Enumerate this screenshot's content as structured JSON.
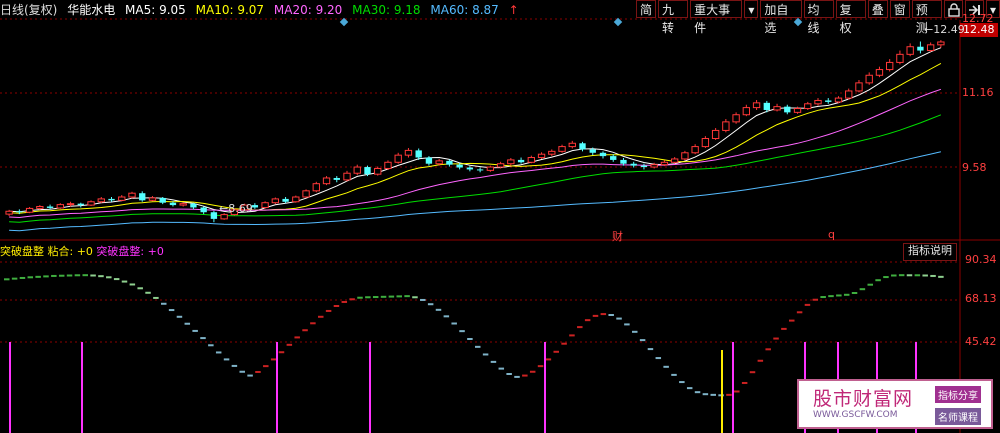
{
  "header": {
    "period": "日线(复权)",
    "stock_name": "华能水电",
    "ma5": "MA5: 9.05",
    "ma10": "MA10: 9.07",
    "ma20": "MA20: 9.20",
    "ma30": "MA30: 9.18",
    "ma60": "MA60: 8.87",
    "arrow": "↑"
  },
  "toolbar": {
    "simple": "简",
    "nine_turn": "九转",
    "major_events": "重大事件",
    "dropdown_arrow": "▾",
    "add_watch": "加自选",
    "ma_line": "均线",
    "adjust": "复权",
    "overlay": "叠",
    "window": "窗",
    "forecast": "预测",
    "lock_icon": "lock-icon",
    "pin_icon": "pin-icon"
  },
  "price_axis": {
    "labels": [
      "12.72",
      "11.16",
      "9.58"
    ],
    "current_price": "12.48"
  },
  "annotations": {
    "high": "12.49",
    "low": "8.69",
    "marker_cai": "财",
    "marker_q": "q"
  },
  "indicator": {
    "name": "突破盘整",
    "stick": "粘合: +0",
    "breakout": "突破盘整: +0",
    "button": "指标说明",
    "axis_labels": [
      "90.34",
      "68.13",
      "45.42"
    ]
  },
  "watermark": {
    "main": "股市财富网",
    "url": "WWW.GSCFW.COM",
    "tag1": "指标分享",
    "tag2": "名师课程"
  },
  "colors": {
    "up": "#ff3838",
    "down": "#55ffff",
    "ma5": "#ffffff",
    "ma10": "#ffff00",
    "ma20": "#ff66ff",
    "ma30": "#00dd00",
    "ma60": "#55bbff",
    "grid": "#8b0000",
    "signal": "#ff33ff",
    "accent_yellow": "#ffee00"
  },
  "chart_data": {
    "type": "candlestick",
    "ylim": [
      8.4,
      12.9
    ],
    "candles": [
      [
        8.86,
        8.92,
        8.82,
        8.95
      ],
      [
        8.92,
        8.9,
        8.86,
        8.96
      ],
      [
        8.9,
        8.98,
        8.88,
        9.01
      ],
      [
        8.98,
        9.02,
        8.95,
        9.05
      ],
      [
        9.02,
        8.99,
        8.96,
        9.06
      ],
      [
        8.99,
        9.06,
        8.97,
        9.09
      ],
      [
        9.06,
        9.08,
        9.02,
        9.12
      ],
      [
        9.08,
        9.05,
        9.0,
        9.1
      ],
      [
        9.05,
        9.12,
        9.03,
        9.15
      ],
      [
        9.12,
        9.18,
        9.09,
        9.22
      ],
      [
        9.18,
        9.15,
        9.12,
        9.22
      ],
      [
        9.15,
        9.22,
        9.13,
        9.26
      ],
      [
        9.22,
        9.3,
        9.19,
        9.33
      ],
      [
        9.3,
        9.15,
        9.12,
        9.34
      ],
      [
        9.15,
        9.2,
        9.13,
        9.24
      ],
      [
        9.2,
        9.1,
        9.07,
        9.22
      ],
      [
        9.1,
        9.05,
        9.02,
        9.13
      ],
      [
        9.05,
        9.08,
        9.02,
        9.11
      ],
      [
        9.08,
        9.0,
        8.96,
        9.1
      ],
      [
        9.0,
        8.9,
        8.86,
        9.02
      ],
      [
        8.9,
        8.76,
        8.69,
        8.93
      ],
      [
        8.76,
        8.85,
        8.74,
        8.88
      ],
      [
        8.85,
        8.95,
        8.83,
        8.98
      ],
      [
        8.95,
        9.05,
        8.93,
        9.08
      ],
      [
        9.05,
        9.0,
        8.97,
        9.09
      ],
      [
        9.0,
        9.1,
        8.98,
        9.13
      ],
      [
        9.1,
        9.18,
        9.07,
        9.21
      ],
      [
        9.18,
        9.12,
        9.09,
        9.22
      ],
      [
        9.12,
        9.22,
        9.1,
        9.25
      ],
      [
        9.22,
        9.35,
        9.2,
        9.38
      ],
      [
        9.35,
        9.5,
        9.32,
        9.54
      ],
      [
        9.5,
        9.62,
        9.47,
        9.66
      ],
      [
        9.62,
        9.58,
        9.53,
        9.66
      ],
      [
        9.58,
        9.72,
        9.55,
        9.77
      ],
      [
        9.72,
        9.85,
        9.68,
        9.9
      ],
      [
        9.85,
        9.7,
        9.66,
        9.88
      ],
      [
        9.7,
        9.82,
        9.67,
        9.86
      ],
      [
        9.82,
        9.95,
        9.79,
        9.99
      ],
      [
        9.95,
        10.1,
        9.92,
        10.15
      ],
      [
        10.1,
        10.2,
        10.05,
        10.25
      ],
      [
        10.2,
        10.05,
        10.0,
        10.24
      ],
      [
        10.05,
        9.92,
        9.88,
        10.08
      ],
      [
        9.92,
        9.98,
        9.88,
        10.02
      ],
      [
        9.98,
        9.9,
        9.86,
        10.01
      ],
      [
        9.9,
        9.84,
        9.8,
        9.93
      ],
      [
        9.84,
        9.8,
        9.76,
        9.87
      ],
      [
        9.8,
        9.78,
        9.74,
        9.84
      ],
      [
        9.78,
        9.85,
        9.75,
        9.88
      ],
      [
        9.85,
        9.92,
        9.82,
        9.96
      ],
      [
        9.92,
        10.0,
        9.88,
        10.04
      ],
      [
        10.0,
        9.95,
        9.92,
        10.05
      ],
      [
        9.95,
        10.05,
        9.93,
        10.09
      ],
      [
        10.05,
        10.12,
        10.02,
        10.16
      ],
      [
        10.12,
        10.18,
        10.08,
        10.22
      ],
      [
        10.18,
        10.28,
        10.15,
        10.32
      ],
      [
        10.28,
        10.35,
        10.24,
        10.4
      ],
      [
        10.35,
        10.22,
        10.18,
        10.38
      ],
      [
        10.22,
        10.15,
        10.1,
        10.26
      ],
      [
        10.15,
        10.08,
        10.03,
        10.18
      ],
      [
        10.08,
        10.0,
        9.96,
        10.12
      ],
      [
        10.0,
        9.92,
        9.88,
        10.04
      ],
      [
        9.92,
        9.88,
        9.84,
        9.96
      ],
      [
        9.88,
        9.85,
        9.8,
        9.92
      ],
      [
        9.85,
        9.9,
        9.82,
        9.94
      ],
      [
        9.9,
        9.95,
        9.87,
        9.99
      ],
      [
        9.95,
        10.02,
        9.92,
        10.06
      ],
      [
        10.02,
        10.15,
        9.99,
        10.19
      ],
      [
        10.15,
        10.28,
        10.12,
        10.33
      ],
      [
        10.28,
        10.45,
        10.25,
        10.5
      ],
      [
        10.45,
        10.62,
        10.42,
        10.67
      ],
      [
        10.62,
        10.8,
        10.58,
        10.86
      ],
      [
        10.8,
        10.95,
        10.76,
        11.0
      ],
      [
        10.95,
        11.1,
        10.92,
        11.16
      ],
      [
        11.1,
        11.2,
        11.05,
        11.26
      ],
      [
        11.2,
        11.05,
        11.0,
        11.24
      ],
      [
        11.05,
        11.12,
        11.02,
        11.18
      ],
      [
        11.12,
        11.0,
        10.96,
        11.16
      ],
      [
        11.0,
        11.08,
        10.97,
        11.12
      ],
      [
        11.08,
        11.18,
        11.05,
        11.22
      ],
      [
        11.18,
        11.25,
        11.14,
        11.3
      ],
      [
        11.25,
        11.22,
        11.18,
        11.3
      ],
      [
        11.22,
        11.3,
        11.19,
        11.34
      ],
      [
        11.3,
        11.45,
        11.27,
        11.5
      ],
      [
        11.45,
        11.62,
        11.42,
        11.68
      ],
      [
        11.62,
        11.78,
        11.58,
        11.84
      ],
      [
        11.78,
        11.9,
        11.74,
        11.96
      ],
      [
        11.9,
        12.05,
        11.86,
        12.12
      ],
      [
        12.05,
        12.22,
        12.01,
        12.3
      ],
      [
        12.22,
        12.38,
        12.18,
        12.45
      ],
      [
        12.38,
        12.3,
        12.24,
        12.49
      ],
      [
        12.3,
        12.42,
        12.27,
        12.47
      ],
      [
        12.42,
        12.48,
        12.36,
        12.52
      ]
    ],
    "indicator_series": [
      88.5,
      88.8,
      89.1,
      89.4,
      89.6,
      89.8,
      90.0,
      90.1,
      90.2,
      90.3,
      90.34,
      90.2,
      89.9,
      89.4,
      88.6,
      87.5,
      86.2,
      84.5,
      82.5,
      80.2,
      77.6,
      74.8,
      71.8,
      68.7,
      65.5,
      62.3,
      59.1,
      55.9,
      52.8,
      49.9,
      47.3,
      45.6,
      47.2,
      49.8,
      52.8,
      56.0,
      59.3,
      62.6,
      65.8,
      68.9,
      71.8,
      74.4,
      76.6,
      78.4,
      79.6,
      80.3,
      80.5,
      80.6,
      80.7,
      80.8,
      80.9,
      81.0,
      80.5,
      79.3,
      77.4,
      74.9,
      72.0,
      68.8,
      65.4,
      61.9,
      58.4,
      55.0,
      51.7,
      48.7,
      46.3,
      45.0,
      45.6,
      47.3,
      49.8,
      52.8,
      56.2,
      59.8,
      63.5,
      67.2,
      70.3,
      72.2,
      73.0,
      72.6,
      71.0,
      68.4,
      65.1,
      61.4,
      57.4,
      53.4,
      49.5,
      45.9,
      42.7,
      40.0,
      38.2,
      37.3,
      37.0,
      36.8,
      37.0,
      38.5,
      42.3,
      47.1,
      52.2,
      57.3,
      62.1,
      66.4,
      70.1,
      73.8,
      77.1,
      79.4,
      80.6,
      81.0,
      81.3,
      81.6,
      82.4,
      84.1,
      86.1,
      88.1,
      89.5,
      90.2,
      90.34,
      90.3,
      90.3,
      90.2,
      90.0,
      89.6
    ],
    "indicator_ylim": [
      20,
      98
    ],
    "signal_bars_x": [
      10,
      82,
      277,
      370,
      545,
      733,
      805,
      838,
      877,
      916
    ],
    "yellow_bar_x": 722
  }
}
